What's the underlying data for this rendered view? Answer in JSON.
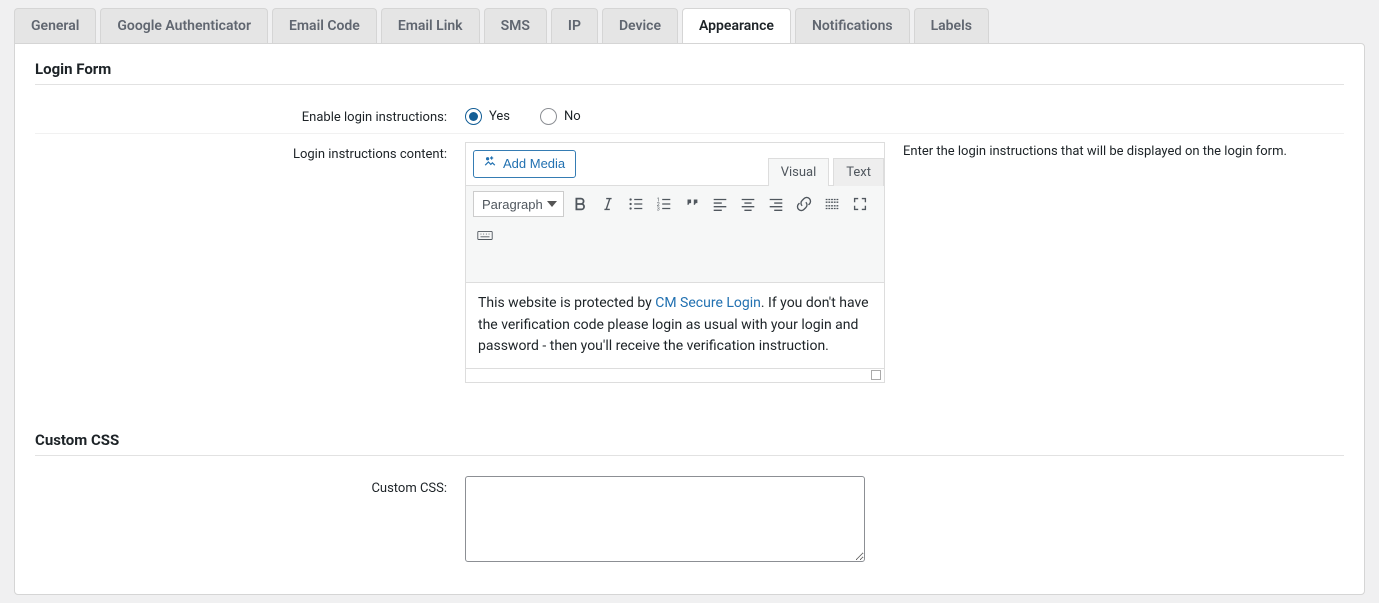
{
  "tabs": [
    {
      "label": "General"
    },
    {
      "label": "Google Authenticator"
    },
    {
      "label": "Email Code"
    },
    {
      "label": "Email Link"
    },
    {
      "label": "SMS"
    },
    {
      "label": "IP"
    },
    {
      "label": "Device"
    },
    {
      "label": "Appearance",
      "active": true
    },
    {
      "label": "Notifications"
    },
    {
      "label": "Labels"
    }
  ],
  "sections": {
    "login_form_title": "Login Form",
    "custom_css_title": "Custom CSS"
  },
  "fields": {
    "enable_instructions_label": "Enable login instructions:",
    "yes": "Yes",
    "no": "No",
    "content_label": "Login instructions content:",
    "add_media": "Add Media",
    "editor_tab_visual": "Visual",
    "editor_tab_text": "Text",
    "paragraph": "Paragraph",
    "help": "Enter the login instructions that will be displayed on the login form.",
    "custom_css_label": "Custom CSS:"
  },
  "editor_content": {
    "prefix": "This website is protected by ",
    "link": "CM Secure Login",
    "suffix": ". If you don't have the verification code please login as usual with your login and password - then you'll receive the verification instruction."
  }
}
